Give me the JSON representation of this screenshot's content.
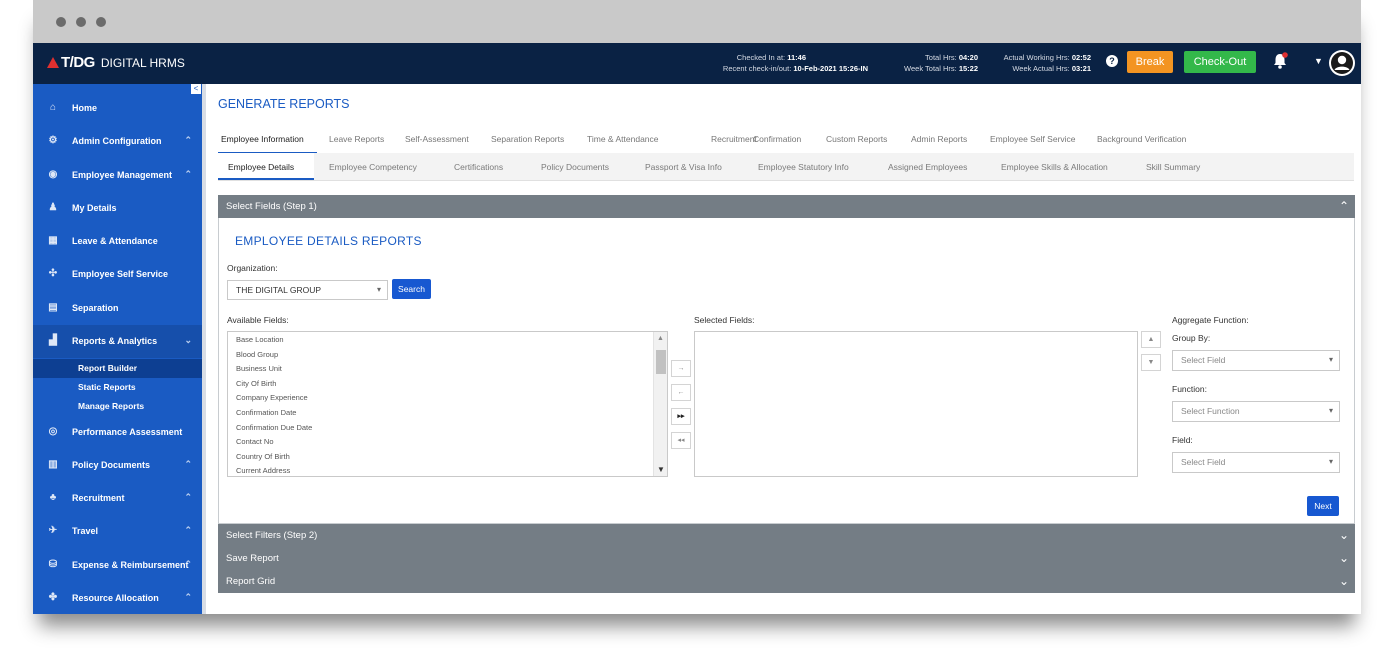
{
  "header": {
    "brand": "T/DG",
    "app_name": "DIGITAL HRMS",
    "checked_in_label": "Checked In at:",
    "checked_in_value": "11:46",
    "recent_label": "Recent check-in/out:",
    "recent_value": "10-Feb-2021 15:26-IN",
    "total_hrs_label": "Total Hrs:",
    "total_hrs_value": "04:20",
    "week_total_label": "Week Total Hrs:",
    "week_total_value": "15:22",
    "actual_label": "Actual Working Hrs:",
    "actual_value": "02:52",
    "week_actual_label": "Week Actual Hrs:",
    "week_actual_value": "03:21",
    "break_label": "Break",
    "checkout_label": "Check-Out",
    "colors": {
      "bar": "#0a2244",
      "break": "#f39422",
      "checkout": "#33b84a",
      "notif_dot": "#e03030"
    }
  },
  "sidebar": {
    "items": [
      {
        "label": "Home",
        "icon": "home-icon",
        "glyph": "⌂",
        "chevron": ""
      },
      {
        "label": "Admin Configuration",
        "icon": "gear-icon",
        "glyph": "⚙",
        "chevron": "⌃"
      },
      {
        "label": "Employee Management",
        "icon": "user-circle-icon",
        "glyph": "◉",
        "chevron": "⌃"
      },
      {
        "label": "My Details",
        "icon": "person-icon",
        "glyph": "♟",
        "chevron": ""
      },
      {
        "label": "Leave & Attendance",
        "icon": "calendar-icon",
        "glyph": "▦",
        "chevron": ""
      },
      {
        "label": "Employee Self Service",
        "icon": "network-icon",
        "glyph": "✣",
        "chevron": ""
      },
      {
        "label": "Separation",
        "icon": "document-exit-icon",
        "glyph": "▤",
        "chevron": ""
      },
      {
        "label": "Reports & Analytics",
        "icon": "chart-icon",
        "glyph": "▟",
        "chevron": "⌄"
      }
    ],
    "sub_items": [
      "Report Builder",
      "Static Reports",
      "Manage Reports"
    ],
    "items_after": [
      {
        "label": "Performance Assessment",
        "icon": "magnify-icon",
        "glyph": "◎",
        "chevron": ""
      },
      {
        "label": "Policy Documents",
        "icon": "file-icon",
        "glyph": "▥",
        "chevron": "⌃"
      },
      {
        "label": "Recruitment",
        "icon": "team-icon",
        "glyph": "♣",
        "chevron": "⌃"
      },
      {
        "label": "Travel",
        "icon": "plane-icon",
        "glyph": "✈",
        "chevron": "⌃"
      },
      {
        "label": "Expense & Reimbursement",
        "icon": "money-icon",
        "glyph": "⛁",
        "chevron": "⌃"
      },
      {
        "label": "Resource Allocation",
        "icon": "resource-icon",
        "glyph": "✤",
        "chevron": "⌃"
      }
    ],
    "collapse_glyph": "<"
  },
  "main": {
    "title": "GENERATE REPORTS",
    "tabs": [
      "Employee Information",
      "Leave Reports",
      "Self-Assessment",
      "Separation Reports",
      "Time & Attendance",
      "Recruitment",
      "Confirmation",
      "Custom Reports",
      "Admin Reports",
      "Employee Self Service",
      "Background Verification"
    ],
    "subtabs": [
      "Employee Details",
      "Employee Competency",
      "Certifications",
      "Policy Documents",
      "Passport & Visa Info",
      "Employee Statutory Info",
      "Assigned Employees",
      "Employee Skills & Allocation",
      "Skill Summary"
    ],
    "step1_title": "Select Fields (Step 1)",
    "section_title": "EMPLOYEE DETAILS REPORTS",
    "org_label": "Organization:",
    "org_value": "THE DIGITAL GROUP",
    "search_label": "Search",
    "available_label": "Available Fields:",
    "available_fields": [
      "Base Location",
      "Blood Group",
      "Business Unit",
      "City Of Birth",
      "Company Experience",
      "Confirmation Date",
      "Confirmation Due Date",
      "Contact No",
      "Country Of Birth",
      "Current Address"
    ],
    "selected_label": "Selected Fields:",
    "aggregate_label": "Aggregate Function:",
    "group_by_label": "Group By:",
    "group_by_placeholder": "Select Field",
    "function_label": "Function:",
    "function_placeholder": "Select Function",
    "field_label": "Field:",
    "field_placeholder": "Select Field",
    "next_label": "Next",
    "step2_title": "Select Filters (Step 2)",
    "save_title": "Save Report",
    "grid_title": "Report Grid"
  }
}
